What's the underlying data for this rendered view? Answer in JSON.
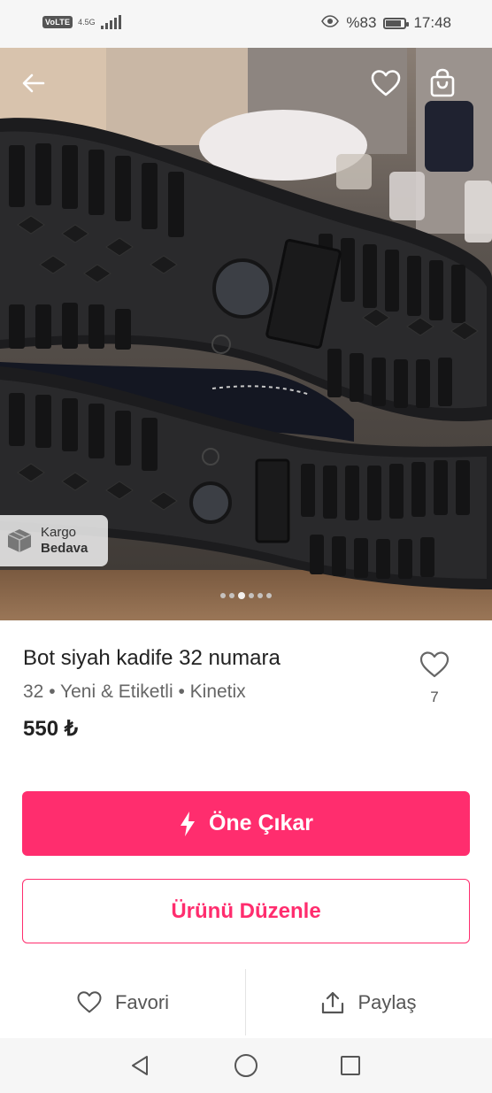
{
  "status_bar": {
    "network_badge": "VoLTE",
    "network_type": "4.5G",
    "battery_percent": "%83",
    "battery_level": 0.83,
    "time": "17:48"
  },
  "header_icons": {
    "back": "arrow-left-icon",
    "favorite": "heart-outline-icon",
    "bag": "shopping-bag-icon"
  },
  "photo": {
    "badge": {
      "line1": "Kargo",
      "line2": "Bedava",
      "icon": "box-icon"
    },
    "dots": {
      "count": 6,
      "active_index": 2
    }
  },
  "product": {
    "title": "Bot siyah kadife 32 numara",
    "meta": "32 • Yeni & Etiketli • Kinetix",
    "price": "550 ₺",
    "like_count": "7"
  },
  "buttons": {
    "promote": "Öne Çıkar",
    "edit": "Ürünü Düzenle"
  },
  "actions": {
    "favorite": "Favori",
    "share": "Paylaş"
  },
  "colors": {
    "accent": "#ff2d6e"
  }
}
